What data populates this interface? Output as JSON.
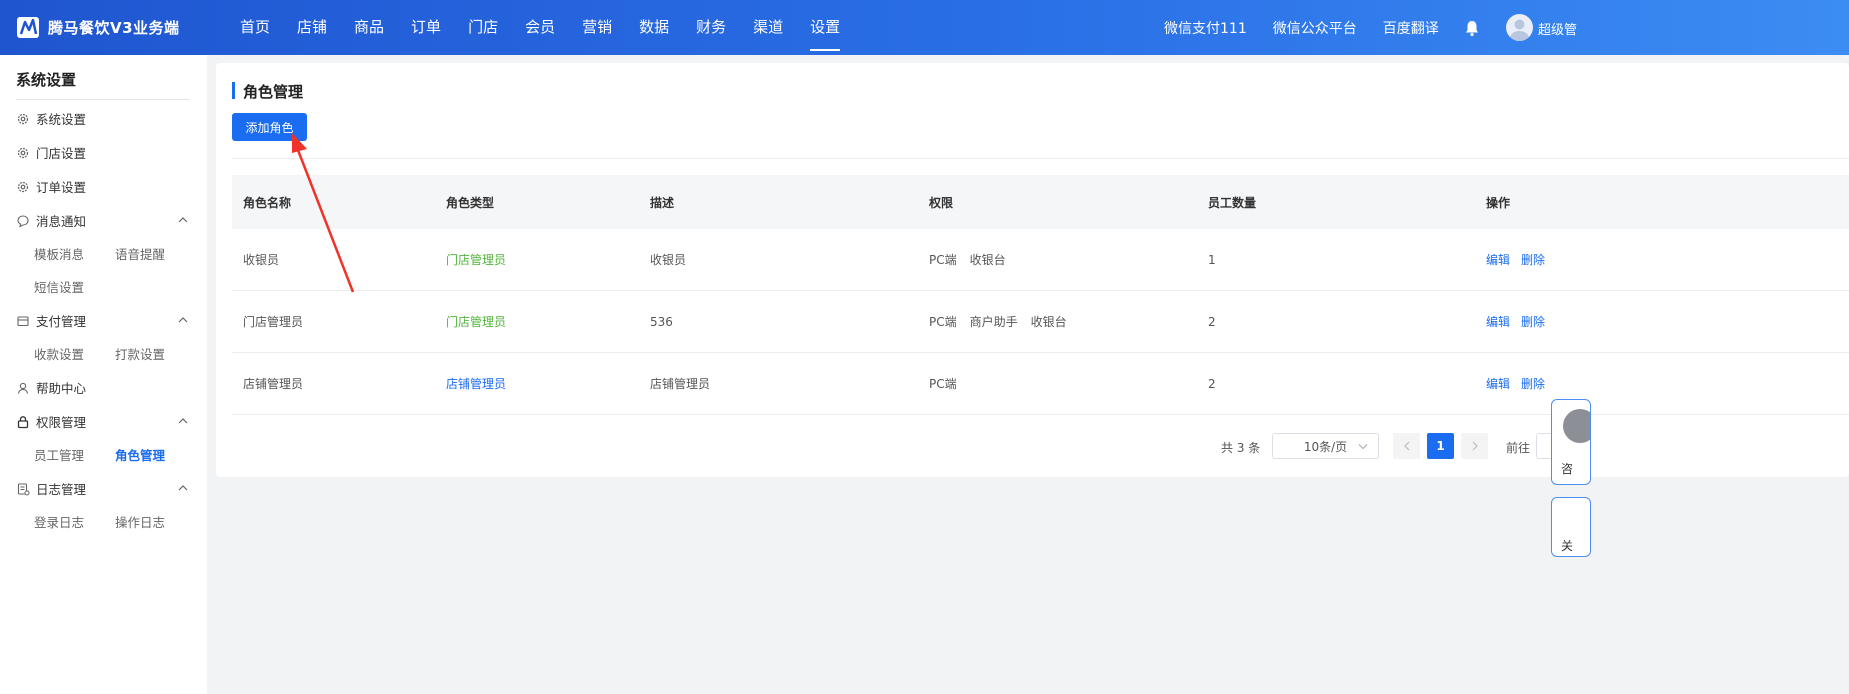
{
  "header": {
    "app_title": "腾马餐饮V3业务端",
    "nav": [
      "首页",
      "店铺",
      "商品",
      "订单",
      "门店",
      "会员",
      "营销",
      "数据",
      "财务",
      "渠道",
      "设置"
    ],
    "active_nav": "设置",
    "right_links": [
      "微信支付111",
      "微信公众平台",
      "百度翻译"
    ],
    "username": "超级管"
  },
  "sidebar": {
    "title": "系统设置",
    "groups": [
      {
        "label": "系统设置",
        "icon": "gear-icon"
      },
      {
        "label": "门店设置",
        "icon": "gear-icon"
      },
      {
        "label": "订单设置",
        "icon": "gear-icon"
      },
      {
        "label": "消息通知",
        "icon": "chat-icon",
        "subs": [
          "模板消息",
          "语音提醒",
          "短信设置"
        ]
      },
      {
        "label": "支付管理",
        "icon": "wallet-icon",
        "subs": [
          "收款设置",
          "打款设置"
        ]
      },
      {
        "label": "帮助中心",
        "icon": "user-icon"
      },
      {
        "label": "权限管理",
        "icon": "lock-icon",
        "subs": [
          "员工管理",
          "角色管理"
        ]
      },
      {
        "label": "日志管理",
        "icon": "log-icon",
        "subs": [
          "登录日志",
          "操作日志"
        ]
      }
    ],
    "active_sub": "角色管理"
  },
  "main": {
    "title": "角色管理",
    "add_button": "添加角色",
    "columns": [
      "角色名称",
      "角色类型",
      "描述",
      "权限",
      "员工数量",
      "操作"
    ],
    "rows": [
      {
        "name": "收银员",
        "type": "门店管理员",
        "desc": "收银员",
        "perms": [
          "PC端",
          "收银台"
        ],
        "count": "1"
      },
      {
        "name": "门店管理员",
        "type": "门店管理员",
        "desc": "536",
        "perms": [
          "PC端",
          "商户助手",
          "收银台"
        ],
        "count": "2"
      },
      {
        "name": "店铺管理员",
        "type": "店铺管理员",
        "desc": "店铺管理员",
        "perms": [
          "PC端"
        ],
        "count": "2"
      }
    ],
    "actions": {
      "edit": "编辑",
      "delete": "删除"
    },
    "pagination": {
      "total_text": "共 3 条",
      "page_size": "10条/页",
      "current_page": "1",
      "goto_label": "前往"
    }
  },
  "floating": {
    "card1_char": "咨",
    "card2_char": "关"
  },
  "colors": {
    "primary": "#1a6cf0",
    "green_tag": "#52b43c",
    "header_start": "#1f56d0",
    "header_end": "#3b8cf3"
  }
}
